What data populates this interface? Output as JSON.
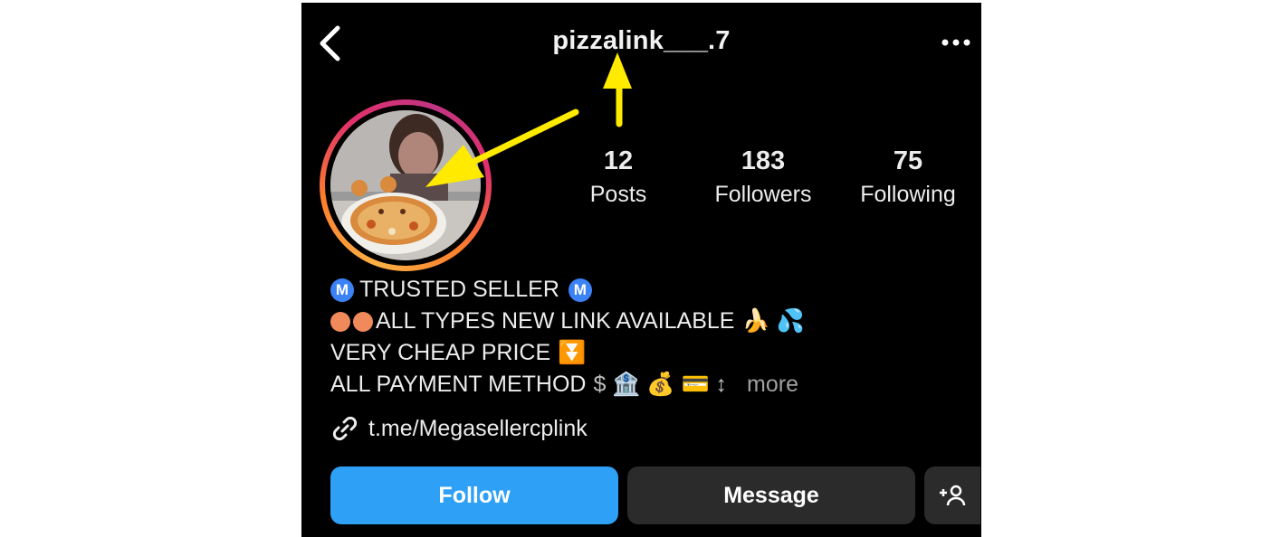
{
  "header": {
    "username": "pizzalink___.7",
    "back_icon": "chevron-left-icon",
    "more_icon": "more-horizontal-icon"
  },
  "stats": [
    {
      "value": "12",
      "label": "Posts"
    },
    {
      "value": "183",
      "label": "Followers"
    },
    {
      "value": "75",
      "label": "Following"
    }
  ],
  "bio": {
    "line1_badge": "M",
    "line1_text": "TRUSTED SELLER",
    "line2_text": "ALL TYPES NEW LINK AVAILABLE",
    "line2_emoji": "🍌 💦",
    "line3_text": "VERY CHEAP PRICE",
    "line3_emoji": "⏬",
    "line4_text": "ALL PAYMENT METHOD",
    "line4_emoji": "$ 🏦 💰 💳 ↕",
    "more_label": "more"
  },
  "link": {
    "text": "t.me/Megasellercplink",
    "icon": "link-icon"
  },
  "actions": {
    "follow_label": "Follow",
    "message_label": "Message",
    "add_user_icon": "add-user-icon"
  },
  "colors": {
    "background": "#000000",
    "follow_button": "#2ea0f5",
    "message_button": "#2b2b2b",
    "annotation_arrow": "#ffea00",
    "verified_badge": "#3b82f6"
  }
}
